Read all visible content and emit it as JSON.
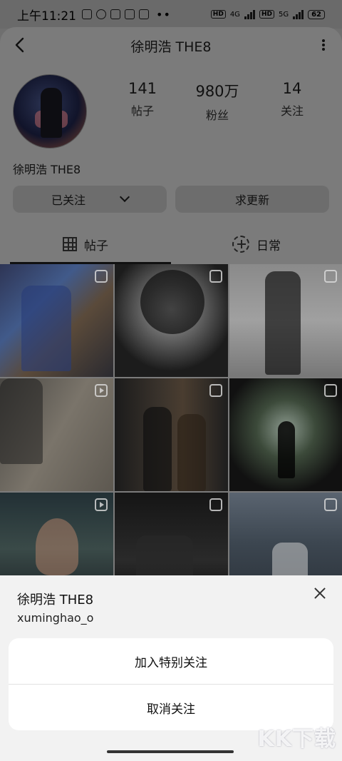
{
  "status_bar": {
    "time": "上午11:21",
    "network_left": "4G",
    "network_right": "5G",
    "battery": "62"
  },
  "header": {
    "title": "徐明浩 THE8"
  },
  "profile": {
    "stats": [
      {
        "value": "141",
        "label": "帖子"
      },
      {
        "value": "980万",
        "label": "粉丝"
      },
      {
        "value": "14",
        "label": "关注"
      }
    ],
    "display_name": "徐明浩 THE8",
    "following_button": "已关注",
    "request_button": "求更新"
  },
  "tabs": [
    {
      "label": "帖子",
      "icon": "grid-icon",
      "active": true
    },
    {
      "label": "日常",
      "icon": "add-circle-icon",
      "active": false
    }
  ],
  "grid": {
    "items": [
      {
        "type": "carousel"
      },
      {
        "type": "carousel"
      },
      {
        "type": "carousel"
      },
      {
        "type": "video"
      },
      {
        "type": "carousel"
      },
      {
        "type": "carousel"
      },
      {
        "type": "video"
      },
      {
        "type": "carousel"
      },
      {
        "type": "carousel"
      }
    ]
  },
  "sheet": {
    "name": "徐明浩 THE8",
    "username": "xuminghao_o",
    "options": [
      "加入特别关注",
      "取消关注"
    ]
  },
  "watermark": "KK下载"
}
